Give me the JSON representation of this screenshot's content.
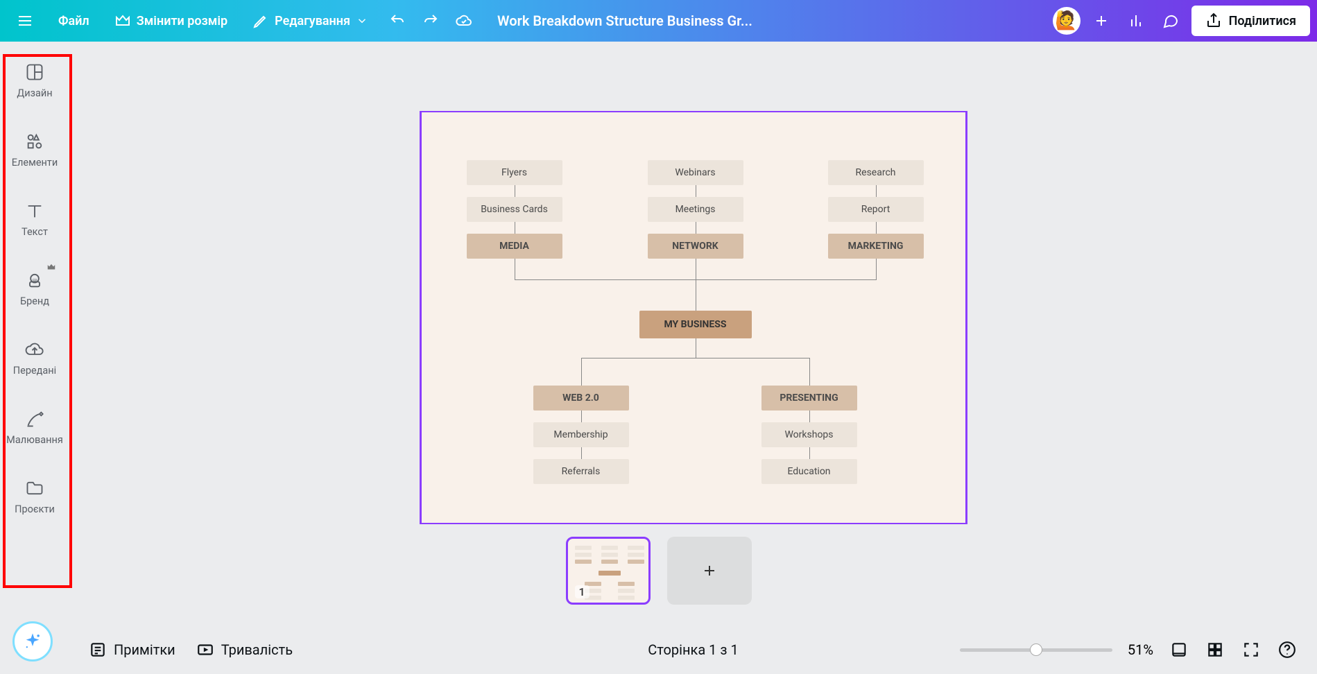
{
  "topbar": {
    "file": "Файл",
    "resize": "Змінити розмір",
    "edit": "Редагування",
    "doc_title": "Work Breakdown Structure Business Gr...",
    "share": "Поділитися"
  },
  "sidebar": {
    "items": [
      {
        "label": "Дизайн",
        "icon": "templates-icon"
      },
      {
        "label": "Елементи",
        "icon": "elements-icon"
      },
      {
        "label": "Текст",
        "icon": "text-icon"
      },
      {
        "label": "Бренд",
        "icon": "brand-icon"
      },
      {
        "label": "Передані",
        "icon": "uploads-icon"
      },
      {
        "label": "Малювання",
        "icon": "draw-icon"
      },
      {
        "label": "Проєкти",
        "icon": "projects-icon"
      }
    ]
  },
  "nodes": {
    "flyers": "Flyers",
    "business_cards": "Business Cards",
    "media": "MEDIA",
    "webinars": "Webinars",
    "meetings": "Meetings",
    "network": "NETWORK",
    "research": "Research",
    "report": "Report",
    "marketing": "MARKETING",
    "my_business": "MY BUSINESS",
    "web20": "WEB 2.0",
    "membership": "Membership",
    "referrals": "Referrals",
    "presenting": "PRESENTING",
    "workshops": "Workshops",
    "education": "Education"
  },
  "bottom": {
    "notes": "Примітки",
    "duration": "Тривалість",
    "page": "Сторінка 1 з 1",
    "zoom": "51%",
    "thumb_num": "1"
  }
}
